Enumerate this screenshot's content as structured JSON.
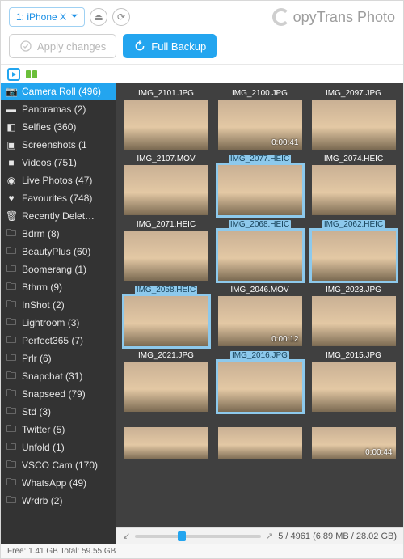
{
  "brand": {
    "name": "opyTrans Photo"
  },
  "topbar": {
    "device": "1: iPhone X"
  },
  "actions": {
    "apply": "Apply changes",
    "backup": "Full Backup"
  },
  "sidebar": {
    "items": [
      {
        "label": "Camera Roll (496)",
        "icon": "📷",
        "active": true
      },
      {
        "label": "Panoramas (2)",
        "icon": "▬"
      },
      {
        "label": "Selfies (360)",
        "icon": "◧"
      },
      {
        "label": "Screenshots (1",
        "icon": "▣"
      },
      {
        "label": "Videos (751)",
        "icon": "■"
      },
      {
        "label": "Live Photos (47)",
        "icon": "◉"
      },
      {
        "label": "Favourites (748)",
        "icon": "♥"
      },
      {
        "label": "Recently Delet…",
        "icon": "🗑"
      },
      {
        "label": "Bdrm (8)",
        "icon": "🗀"
      },
      {
        "label": "BeautyPlus (60)",
        "icon": "🗀"
      },
      {
        "label": "Boomerang (1)",
        "icon": "🗀"
      },
      {
        "label": "Bthrm (9)",
        "icon": "🗀"
      },
      {
        "label": "InShot (2)",
        "icon": "🗀"
      },
      {
        "label": "Lightroom (3)",
        "icon": "🗀"
      },
      {
        "label": "Perfect365 (7)",
        "icon": "🗀"
      },
      {
        "label": "Prlr (6)",
        "icon": "🗀"
      },
      {
        "label": "Snapchat (31)",
        "icon": "🗀"
      },
      {
        "label": "Snapseed (79)",
        "icon": "🗀"
      },
      {
        "label": "Std (3)",
        "icon": "🗀"
      },
      {
        "label": "Twitter (5)",
        "icon": "🗀"
      },
      {
        "label": "Unfold (1)",
        "icon": "🗀"
      },
      {
        "label": "VSCO Cam (170)",
        "icon": "🗀"
      },
      {
        "label": "WhatsApp (49)",
        "icon": "🗀"
      },
      {
        "label": "Wrdrb (2)",
        "icon": "🗀"
      }
    ]
  },
  "grid": {
    "items": [
      {
        "name": "IMG_2101.JPG",
        "cls": "sky1"
      },
      {
        "name": "IMG_2100.JPG",
        "cls": "sky1",
        "dur": "0:00:41"
      },
      {
        "name": "IMG_2097.JPG",
        "cls": "sky2"
      },
      {
        "name": "IMG_2107.MOV",
        "cls": "rocks"
      },
      {
        "name": "IMG_2077.HEIC",
        "cls": "sky1",
        "sel": true
      },
      {
        "name": "IMG_2074.HEIC",
        "cls": "sky2"
      },
      {
        "name": "IMG_2071.HEIC",
        "cls": "couple"
      },
      {
        "name": "IMG_2068.HEIC",
        "cls": "sky1",
        "sel": true
      },
      {
        "name": "IMG_2062.HEIC",
        "cls": "sky2",
        "sel": true
      },
      {
        "name": "IMG_2058.HEIC",
        "cls": "couple",
        "sel": true
      },
      {
        "name": "IMG_2046.MOV",
        "cls": "balloon",
        "dur": "0:00:12"
      },
      {
        "name": "IMG_2023.JPG",
        "cls": "sunset"
      },
      {
        "name": "IMG_2021.JPG",
        "cls": "balloon"
      },
      {
        "name": "IMG_2016.JPG",
        "cls": "sunset",
        "sel": true
      },
      {
        "name": "IMG_2015.JPG",
        "cls": "sunset"
      }
    ],
    "last_row": [
      {
        "cls": "rocks"
      },
      {
        "cls": "balloon"
      },
      {
        "cls": "rocks",
        "dur": "0:00:44"
      }
    ]
  },
  "gridbar": {
    "summary": "5 / 4961 (6.89 MB / 28.02 GB)"
  },
  "status": {
    "free": "Free: 1.41 GB Total: 59.55 GB"
  }
}
